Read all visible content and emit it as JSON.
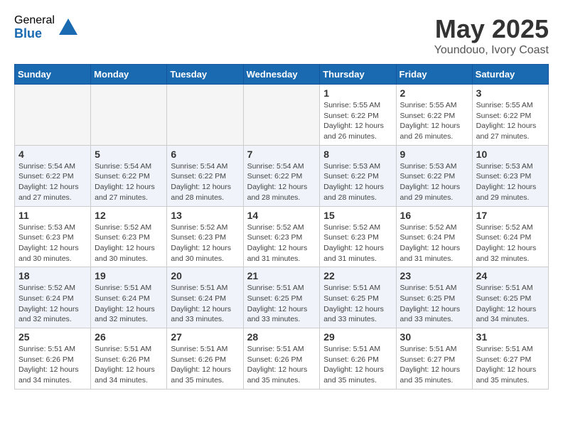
{
  "header": {
    "logo_general": "General",
    "logo_blue": "Blue",
    "month_year": "May 2025",
    "location": "Youndouo, Ivory Coast"
  },
  "days_of_week": [
    "Sunday",
    "Monday",
    "Tuesday",
    "Wednesday",
    "Thursday",
    "Friday",
    "Saturday"
  ],
  "weeks": [
    [
      {
        "day": "",
        "info": ""
      },
      {
        "day": "",
        "info": ""
      },
      {
        "day": "",
        "info": ""
      },
      {
        "day": "",
        "info": ""
      },
      {
        "day": "1",
        "info": "Sunrise: 5:55 AM\nSunset: 6:22 PM\nDaylight: 12 hours\nand 26 minutes."
      },
      {
        "day": "2",
        "info": "Sunrise: 5:55 AM\nSunset: 6:22 PM\nDaylight: 12 hours\nand 26 minutes."
      },
      {
        "day": "3",
        "info": "Sunrise: 5:55 AM\nSunset: 6:22 PM\nDaylight: 12 hours\nand 27 minutes."
      }
    ],
    [
      {
        "day": "4",
        "info": "Sunrise: 5:54 AM\nSunset: 6:22 PM\nDaylight: 12 hours\nand 27 minutes."
      },
      {
        "day": "5",
        "info": "Sunrise: 5:54 AM\nSunset: 6:22 PM\nDaylight: 12 hours\nand 27 minutes."
      },
      {
        "day": "6",
        "info": "Sunrise: 5:54 AM\nSunset: 6:22 PM\nDaylight: 12 hours\nand 28 minutes."
      },
      {
        "day": "7",
        "info": "Sunrise: 5:54 AM\nSunset: 6:22 PM\nDaylight: 12 hours\nand 28 minutes."
      },
      {
        "day": "8",
        "info": "Sunrise: 5:53 AM\nSunset: 6:22 PM\nDaylight: 12 hours\nand 28 minutes."
      },
      {
        "day": "9",
        "info": "Sunrise: 5:53 AM\nSunset: 6:22 PM\nDaylight: 12 hours\nand 29 minutes."
      },
      {
        "day": "10",
        "info": "Sunrise: 5:53 AM\nSunset: 6:23 PM\nDaylight: 12 hours\nand 29 minutes."
      }
    ],
    [
      {
        "day": "11",
        "info": "Sunrise: 5:53 AM\nSunset: 6:23 PM\nDaylight: 12 hours\nand 30 minutes."
      },
      {
        "day": "12",
        "info": "Sunrise: 5:52 AM\nSunset: 6:23 PM\nDaylight: 12 hours\nand 30 minutes."
      },
      {
        "day": "13",
        "info": "Sunrise: 5:52 AM\nSunset: 6:23 PM\nDaylight: 12 hours\nand 30 minutes."
      },
      {
        "day": "14",
        "info": "Sunrise: 5:52 AM\nSunset: 6:23 PM\nDaylight: 12 hours\nand 31 minutes."
      },
      {
        "day": "15",
        "info": "Sunrise: 5:52 AM\nSunset: 6:23 PM\nDaylight: 12 hours\nand 31 minutes."
      },
      {
        "day": "16",
        "info": "Sunrise: 5:52 AM\nSunset: 6:24 PM\nDaylight: 12 hours\nand 31 minutes."
      },
      {
        "day": "17",
        "info": "Sunrise: 5:52 AM\nSunset: 6:24 PM\nDaylight: 12 hours\nand 32 minutes."
      }
    ],
    [
      {
        "day": "18",
        "info": "Sunrise: 5:52 AM\nSunset: 6:24 PM\nDaylight: 12 hours\nand 32 minutes."
      },
      {
        "day": "19",
        "info": "Sunrise: 5:51 AM\nSunset: 6:24 PM\nDaylight: 12 hours\nand 32 minutes."
      },
      {
        "day": "20",
        "info": "Sunrise: 5:51 AM\nSunset: 6:24 PM\nDaylight: 12 hours\nand 33 minutes."
      },
      {
        "day": "21",
        "info": "Sunrise: 5:51 AM\nSunset: 6:25 PM\nDaylight: 12 hours\nand 33 minutes."
      },
      {
        "day": "22",
        "info": "Sunrise: 5:51 AM\nSunset: 6:25 PM\nDaylight: 12 hours\nand 33 minutes."
      },
      {
        "day": "23",
        "info": "Sunrise: 5:51 AM\nSunset: 6:25 PM\nDaylight: 12 hours\nand 33 minutes."
      },
      {
        "day": "24",
        "info": "Sunrise: 5:51 AM\nSunset: 6:25 PM\nDaylight: 12 hours\nand 34 minutes."
      }
    ],
    [
      {
        "day": "25",
        "info": "Sunrise: 5:51 AM\nSunset: 6:26 PM\nDaylight: 12 hours\nand 34 minutes."
      },
      {
        "day": "26",
        "info": "Sunrise: 5:51 AM\nSunset: 6:26 PM\nDaylight: 12 hours\nand 34 minutes."
      },
      {
        "day": "27",
        "info": "Sunrise: 5:51 AM\nSunset: 6:26 PM\nDaylight: 12 hours\nand 35 minutes."
      },
      {
        "day": "28",
        "info": "Sunrise: 5:51 AM\nSunset: 6:26 PM\nDaylight: 12 hours\nand 35 minutes."
      },
      {
        "day": "29",
        "info": "Sunrise: 5:51 AM\nSunset: 6:26 PM\nDaylight: 12 hours\nand 35 minutes."
      },
      {
        "day": "30",
        "info": "Sunrise: 5:51 AM\nSunset: 6:27 PM\nDaylight: 12 hours\nand 35 minutes."
      },
      {
        "day": "31",
        "info": "Sunrise: 5:51 AM\nSunset: 6:27 PM\nDaylight: 12 hours\nand 35 minutes."
      }
    ]
  ]
}
